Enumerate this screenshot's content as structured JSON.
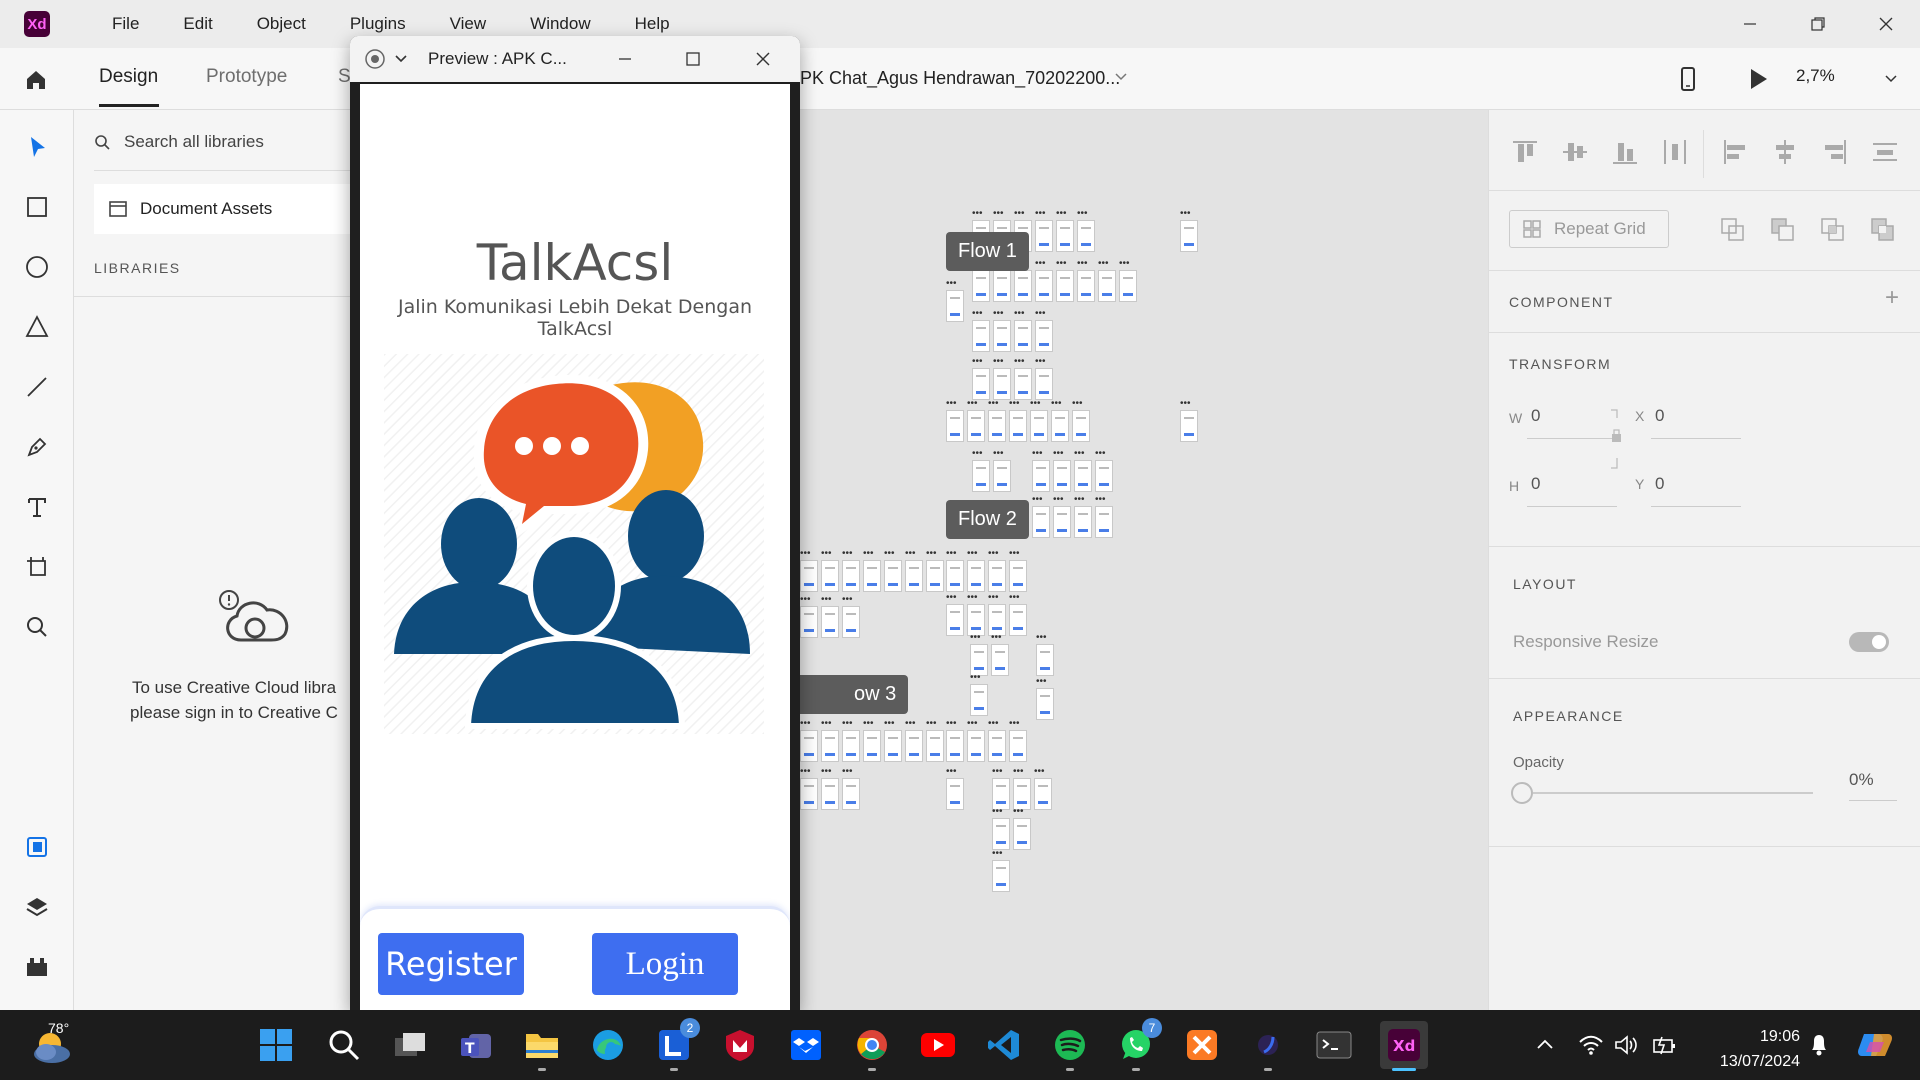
{
  "app": {
    "logo_text": "Xd",
    "accent": "#ff61f6",
    "brand_bg": "#470137"
  },
  "menu": [
    "File",
    "Edit",
    "Object",
    "Plugins",
    "View",
    "Window",
    "Help"
  ],
  "toolbar": {
    "tabs": [
      {
        "label": "Design",
        "active": true
      },
      {
        "label": "Prototype",
        "active": false
      },
      {
        "label": "S",
        "active": false
      }
    ],
    "document_title": "PK Chat_Agus Hendrawan_70202200...",
    "zoom": "2,7%"
  },
  "libraries": {
    "search_placeholder": "Search all libraries",
    "document_assets": "Document Assets",
    "heading": "LIBRARIES",
    "message_line1": "To use Creative Cloud libra",
    "message_line2": "please sign in to Creative C"
  },
  "properties": {
    "repeat_grid": "Repeat Grid",
    "component": "COMPONENT",
    "transform": "TRANSFORM",
    "w_label": "W",
    "w": "0",
    "h_label": "H",
    "h": "0",
    "x_label": "X",
    "x": "0",
    "y_label": "Y",
    "y": "0",
    "layout": "LAYOUT",
    "responsive_resize": "Responsive Resize",
    "appearance": "APPEARANCE",
    "opacity_label": "Opacity",
    "opacity": "0%"
  },
  "canvas": {
    "flows": [
      "Flow 1",
      "Flow 2",
      "ow 3"
    ]
  },
  "preview": {
    "window_title": "Preview : APK C...",
    "app_title": "TalkAcsl",
    "app_subtitle": "Jalin Komunikasi Lebih Dekat Dengan TalkAcsl",
    "register_label": "Register",
    "login_label": "Login",
    "button_color": "#3e6ef0"
  },
  "taskbar": {
    "weather_temp": "78°",
    "teams_badge": "2",
    "whatsapp_badge": "7",
    "time": "19:06",
    "date": "13/07/2024"
  }
}
